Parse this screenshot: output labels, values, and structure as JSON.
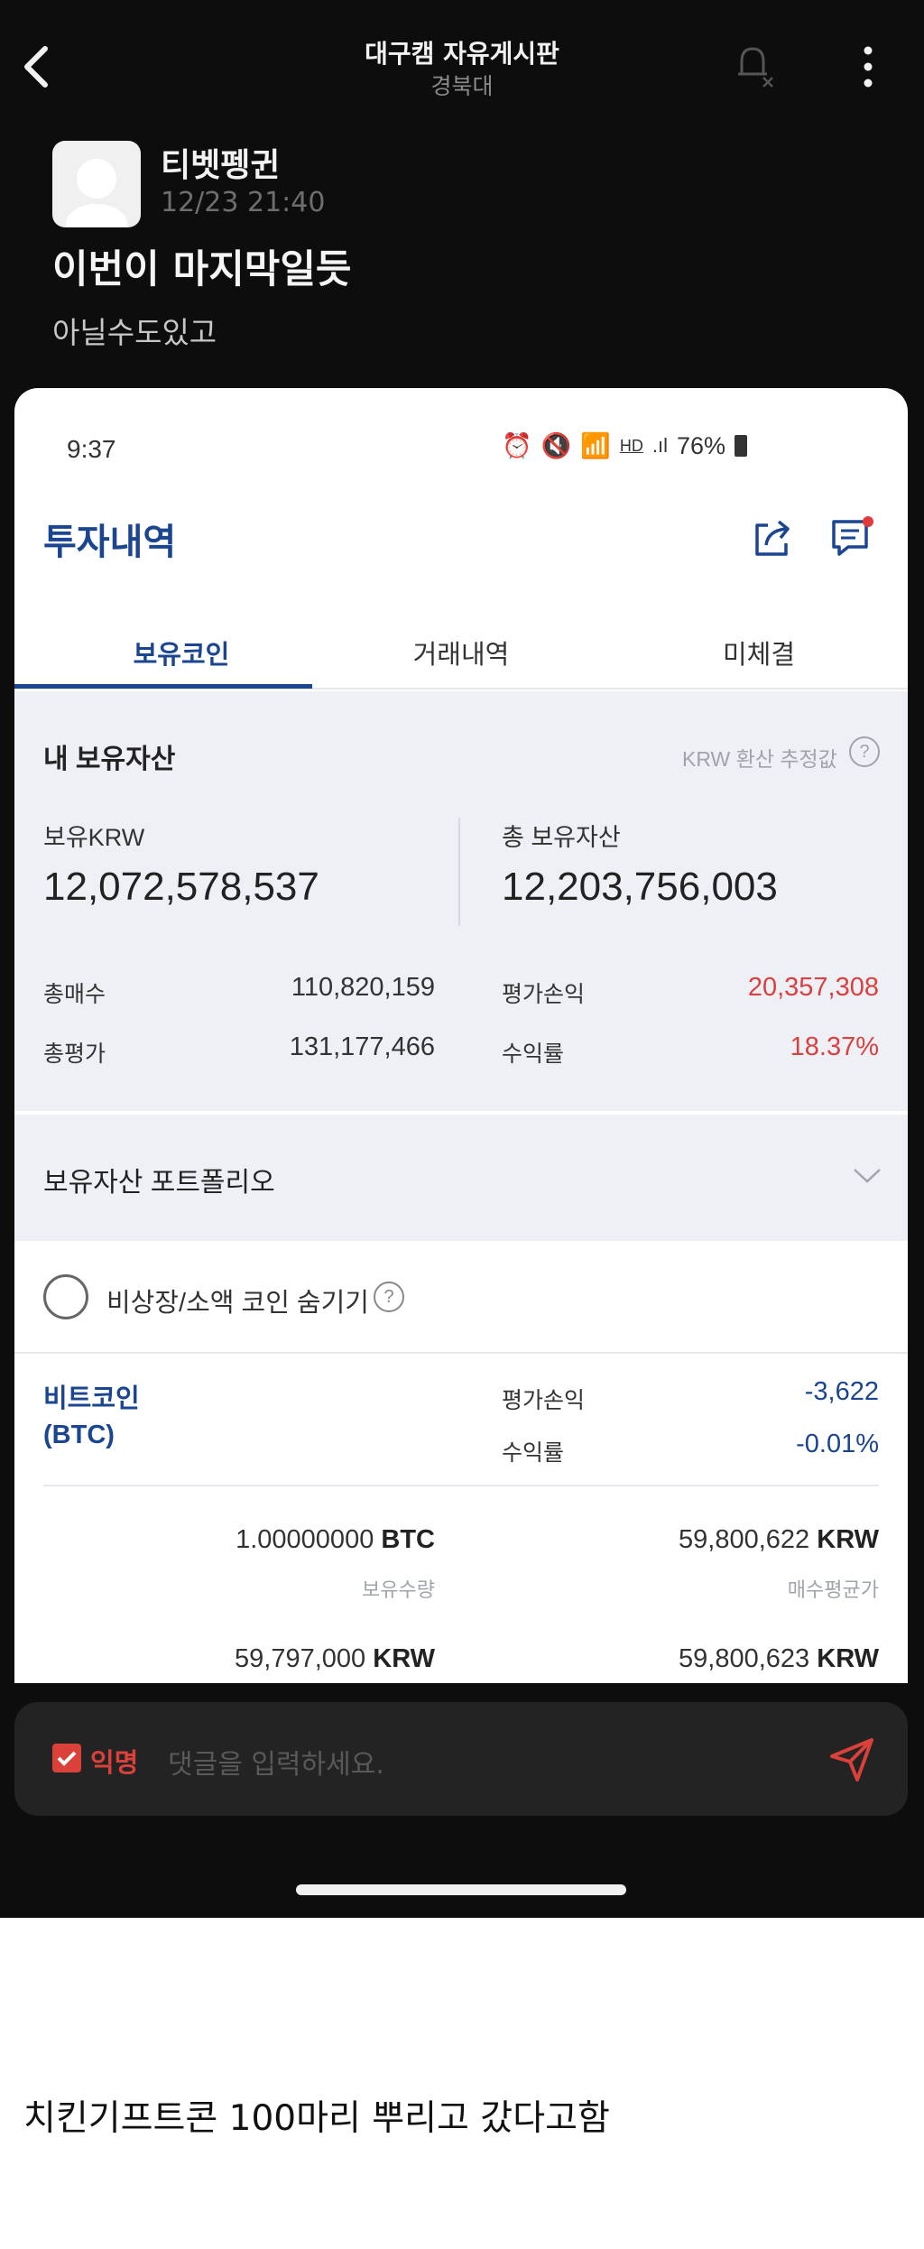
{
  "board": {
    "title": "대구캠 자유게시판",
    "subtitle": "경북대"
  },
  "post": {
    "author": "티벳펭귄",
    "time": "12/23 21:40",
    "title": "이번이 마지막일듯",
    "body": "아닐수도있고"
  },
  "screenshot": {
    "status": {
      "time": "9:37",
      "battery": "76%",
      "hd": "HD"
    },
    "page_title": "투자내역",
    "tabs": [
      "보유코인",
      "거래내역",
      "미체결"
    ],
    "summary": {
      "title": "내 보유자산",
      "krw_note": "KRW 환산 추정값",
      "holdings_krw_label": "보유KRW",
      "holdings_krw_value": "12,072,578,537",
      "total_assets_label": "총 보유자산",
      "total_assets_value": "12,203,756,003",
      "total_buy_label": "총매수",
      "total_buy_value": "110,820,159",
      "total_eval_label": "총평가",
      "total_eval_value": "131,177,466",
      "pnl_label": "평가손익",
      "pnl_value": "20,357,308",
      "return_label": "수익률",
      "return_value": "18.37%"
    },
    "portfolio_label": "보유자산 포트폴리오",
    "hide_small_label": "비상장/소액 코인 숨기기",
    "coin": {
      "name": "비트코인",
      "ticker": "(BTC)",
      "pnl_label": "평가손익",
      "pnl_value": "-3,622",
      "return_label": "수익률",
      "return_value": "-0.01%",
      "qty_value": "1.00000000",
      "qty_unit": "BTC",
      "qty_label": "보유수량",
      "avg_value": "59,800,622",
      "avg_unit": "KRW",
      "avg_label": "매수평균가",
      "buy_value": "59,797,000",
      "buy_unit": "KRW",
      "eval_value": "59,800,623",
      "eval_unit": "KRW"
    }
  },
  "comment": {
    "anon_label": "익명",
    "placeholder": "댓글을 입력하세요."
  },
  "caption": "치킨기프트콘 100마리 뿌리고 갔다고함",
  "colors": {
    "accent_blue": "#1a4590",
    "loss_red": "#d94040",
    "comment_red": "#d9413a",
    "bg_dark": "#0d0d0d"
  },
  "icons": [
    "back-icon",
    "bell-off-icon",
    "more-icon",
    "share-icon",
    "chat-icon",
    "chevron-down-icon",
    "send-icon",
    "help-icon"
  ]
}
